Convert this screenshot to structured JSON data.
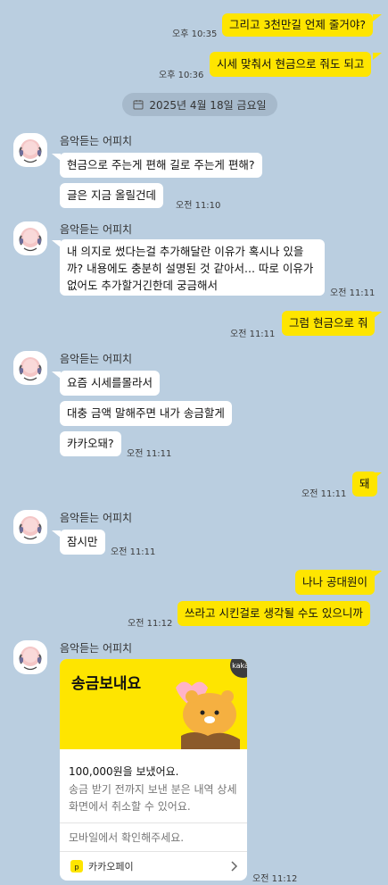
{
  "messages": {
    "m1": {
      "text": "그리고 3천만길 언제 줄거야?",
      "time": "오후 10:35"
    },
    "m2": {
      "text": "시세 맞춰서 현금으로 줘도 되고",
      "time": "오후 10:36"
    },
    "date": "2025년 4월 18일 금요일",
    "sender": "음악듣는 어피치",
    "o1a": "현금으로 주는게 편해 길로 주는게 편해?",
    "o1b": {
      "text": "글은 지금 올릴건데",
      "time": "오전 11:10"
    },
    "o2": {
      "text": "내 의지로 썼다는걸 추가해달란 이유가 혹시나 있을까?  내용에도 충분히 설명된 것 같아서... 따로 이유가 없어도 추가할거긴한데 궁금해서",
      "time": "오전 11:11"
    },
    "m3": {
      "text": "그럼 현금으로 줘",
      "time": "오전 11:11"
    },
    "o3a": "요즘 시세를몰라서",
    "o3b": "대충 금액 말해주면 내가 송금할게",
    "o3c": {
      "text": "카카오돼?",
      "time": "오전 11:11"
    },
    "m4": {
      "text": "돼",
      "time": "오전 11:11"
    },
    "o4": {
      "text": "잠시만",
      "time": "오전 11:11"
    },
    "m5": {
      "text": "나나 공대원이"
    },
    "m6": {
      "text": "쓰라고 시킨걸로 생각될 수도 있으니까",
      "time": "오전 11:12"
    },
    "card": {
      "title": "송금보내요",
      "badge": "kakao",
      "amount": "100,000원을 보냈어요.",
      "desc": "송금 받기 전까지 보낸 분은 내역 상세화면에서 취소할 수 있어요.",
      "notice": "모바일에서 확인해주세요.",
      "brand": "카카오페이",
      "time": "오전 11:12"
    }
  },
  "colors": {
    "background": "#bacee0",
    "my_bubble": "#fee500",
    "other_bubble": "#ffffff"
  },
  "icons": [
    "calendar-icon",
    "avatar-apeach",
    "kakaopay-icon",
    "chevron-right-icon",
    "ryan-character"
  ]
}
